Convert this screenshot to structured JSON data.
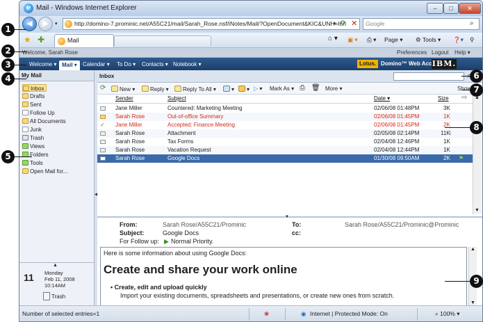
{
  "window": {
    "title": "Mail - Windows Internet Explorer",
    "minimize": "–",
    "maximize": "□",
    "close": "✕"
  },
  "browser": {
    "url": "http://domino-7.prominic.net/A55C21/mail/Sarah_Rose.nsf/iNotes/Mail/?OpenDocument&KIC&UNH=l6n",
    "search_placeholder": "Google",
    "tab_label": "Mail",
    "cmd_page": "Page ▾",
    "cmd_tools": "Tools ▾"
  },
  "callouts": [
    "1",
    "2",
    "3",
    "4",
    "5",
    "6",
    "7",
    "8",
    "9"
  ],
  "header": {
    "welcome": "Welcome, Sarah Rose",
    "preferences": "Preferences",
    "logout": "Logout",
    "help": "Help ▾"
  },
  "nav_tabs": [
    "Welcome ▾",
    "Mail ▾",
    "Calendar ▾",
    "To Do ▾",
    "Contacts ▾",
    "Notebook ▾"
  ],
  "brand": {
    "lotus": "Lotus.",
    "product": "Domino™ Web Access",
    "ibm": "IBM."
  },
  "sidebar": {
    "heading": "My Mail",
    "folders": [
      "Inbox",
      "Drafts",
      "Sent",
      "Follow Up",
      "All Documents",
      "Junk",
      "Trash",
      "Views",
      "Folders",
      "Tools",
      "Open Mail for..."
    ],
    "calendar": {
      "day_number": "11",
      "weekday": "Monday",
      "date": "Feb 11, 2008",
      "time": "10:14AM",
      "trash": "Trash"
    }
  },
  "main": {
    "title": "Inbox",
    "toolbar": {
      "new": "New ▾",
      "reply": "Reply ▾",
      "reply_all": "Reply To All ▾",
      "mark_as": "Mark As ▾",
      "more": "More ▾",
      "show": "Show ▾"
    },
    "columns": {
      "sender": "Sender",
      "subject": "Subject",
      "date": "Date ▾",
      "size": "Size"
    },
    "messages": [
      {
        "sender": "Jane Miller",
        "subject": "Countered: Marketing Meeting",
        "date": "02/06/08 01:48PM",
        "size": "3K"
      },
      {
        "sender": "Sarah Rose",
        "subject": "Out-of-office Summary",
        "date": "02/06/08 01:45PM",
        "size": "1K"
      },
      {
        "sender": "Jane Miller",
        "subject": "Accepted: Finance Meeting",
        "date": "02/06/08 01:45PM",
        "size": "2K"
      },
      {
        "sender": "Sarah Rose",
        "subject": "Attachment",
        "date": "02/05/08 02:14PM",
        "size": "11K"
      },
      {
        "sender": "Sarah Rose",
        "subject": "Tax Forms",
        "date": "02/04/08 12:46PM",
        "size": "1K"
      },
      {
        "sender": "Sarah Rose",
        "subject": "Vacation Request",
        "date": "02/04/08 12:44PM",
        "size": "1K"
      },
      {
        "sender": "Sarah Rose",
        "subject": "Google Docs",
        "date": "01/30/08 09:50AM",
        "size": "2K"
      }
    ]
  },
  "preview": {
    "from_label": "From:",
    "from_value": "Sarah Rose/A55C21/Prominic",
    "to_label": "To:",
    "to_value": "Sarah Rose/A55C21/Prominic@Prominic",
    "subject_label": "Subject:",
    "subject_value": "Google Docs",
    "cc_label": "cc:",
    "followup_label": "For Follow up:",
    "followup_value": "Normal Priority.",
    "body_intro": "Here is some information about using Google Docs:",
    "body_heading": "Create and share your work online",
    "bullet": "Create, edit and upload quickly",
    "bullet_desc": "Import your existing documents, spreadsheets and presentations, or create new ones from scratch."
  },
  "status": {
    "selected": "Number of selected entries=1",
    "zone": "Internet | Protected Mode: On",
    "zoom": "100%"
  }
}
